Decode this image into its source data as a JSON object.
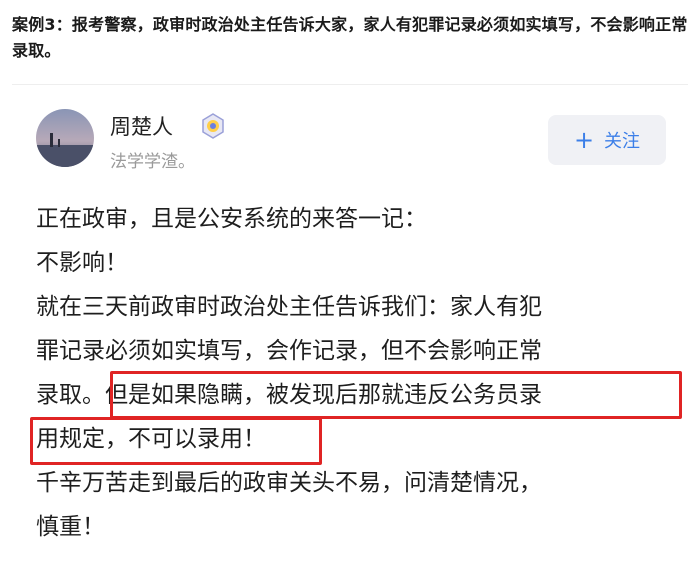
{
  "headline": "案例3：报考警察，政审时政治处主任告诉大家，家人有犯罪记录必须如实填写，不会影响正常录取。",
  "profile": {
    "name": "周楚人",
    "bio": "法学学渣。",
    "follow_label": "关注"
  },
  "post": {
    "line1": "正在政审，且是公安系统的来答一记：",
    "line2": "不影响！",
    "line3": "就在三天前政审时政治处主任告诉我们：家人有犯",
    "line4": "罪记录必须如实填写，会作记录，但不会影响正常",
    "line5_prefix": "录取。",
    "line5_highlight": "但是如果隐瞒，被发现后那就违反公务员录",
    "line6_highlight": "用规定，不可以录用！",
    "line7": "千辛万苦走到最后的政审关头不易，问清楚情况，",
    "line8": "慎重！"
  },
  "colors": {
    "accent": "#3c7fe8",
    "highlight_border": "#e02424"
  }
}
